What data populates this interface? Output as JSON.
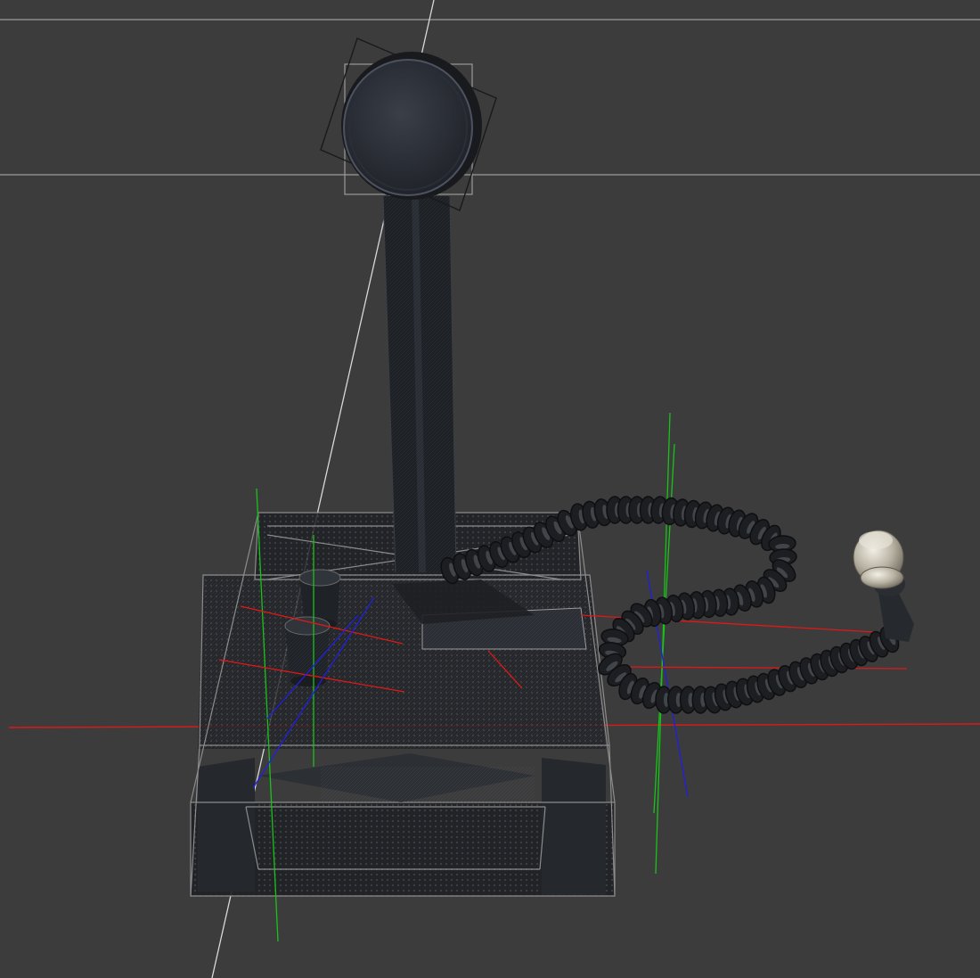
{
  "viewport": {
    "background": "#3c3c3c",
    "view": "perspective",
    "grid": true
  },
  "colors": {
    "grid_line": "#9a9a9a",
    "world_line": "#d8d8d8",
    "axis_x": "#e01818",
    "axis_y": "#19c219",
    "axis_z": "#2020e0",
    "mesh_dark": "#1b1d21",
    "mesh_wire": "#8c8c8c",
    "selection_box": "#9a9a9a",
    "cable": "#1c1e21",
    "cable_highlight": "#5a5f66",
    "jack_metal": "#c7c2b5"
  },
  "scene_objects": [
    {
      "name": "mic-head",
      "icon": "microphone-head-icon",
      "selected": true
    },
    {
      "name": "mic-stem",
      "icon": "stem-icon",
      "selected": false
    },
    {
      "name": "mic-base",
      "icon": "base-box-icon",
      "selected": false
    },
    {
      "name": "knob-rear",
      "icon": "knob-icon",
      "selected": false
    },
    {
      "name": "knob-front",
      "icon": "knob-icon",
      "selected": false
    },
    {
      "name": "button-plate",
      "icon": "plate-icon",
      "selected": false
    },
    {
      "name": "coiled-cable",
      "icon": "cable-icon",
      "selected": false
    },
    {
      "name": "audio-jack",
      "icon": "jack-icon",
      "selected": false
    }
  ]
}
